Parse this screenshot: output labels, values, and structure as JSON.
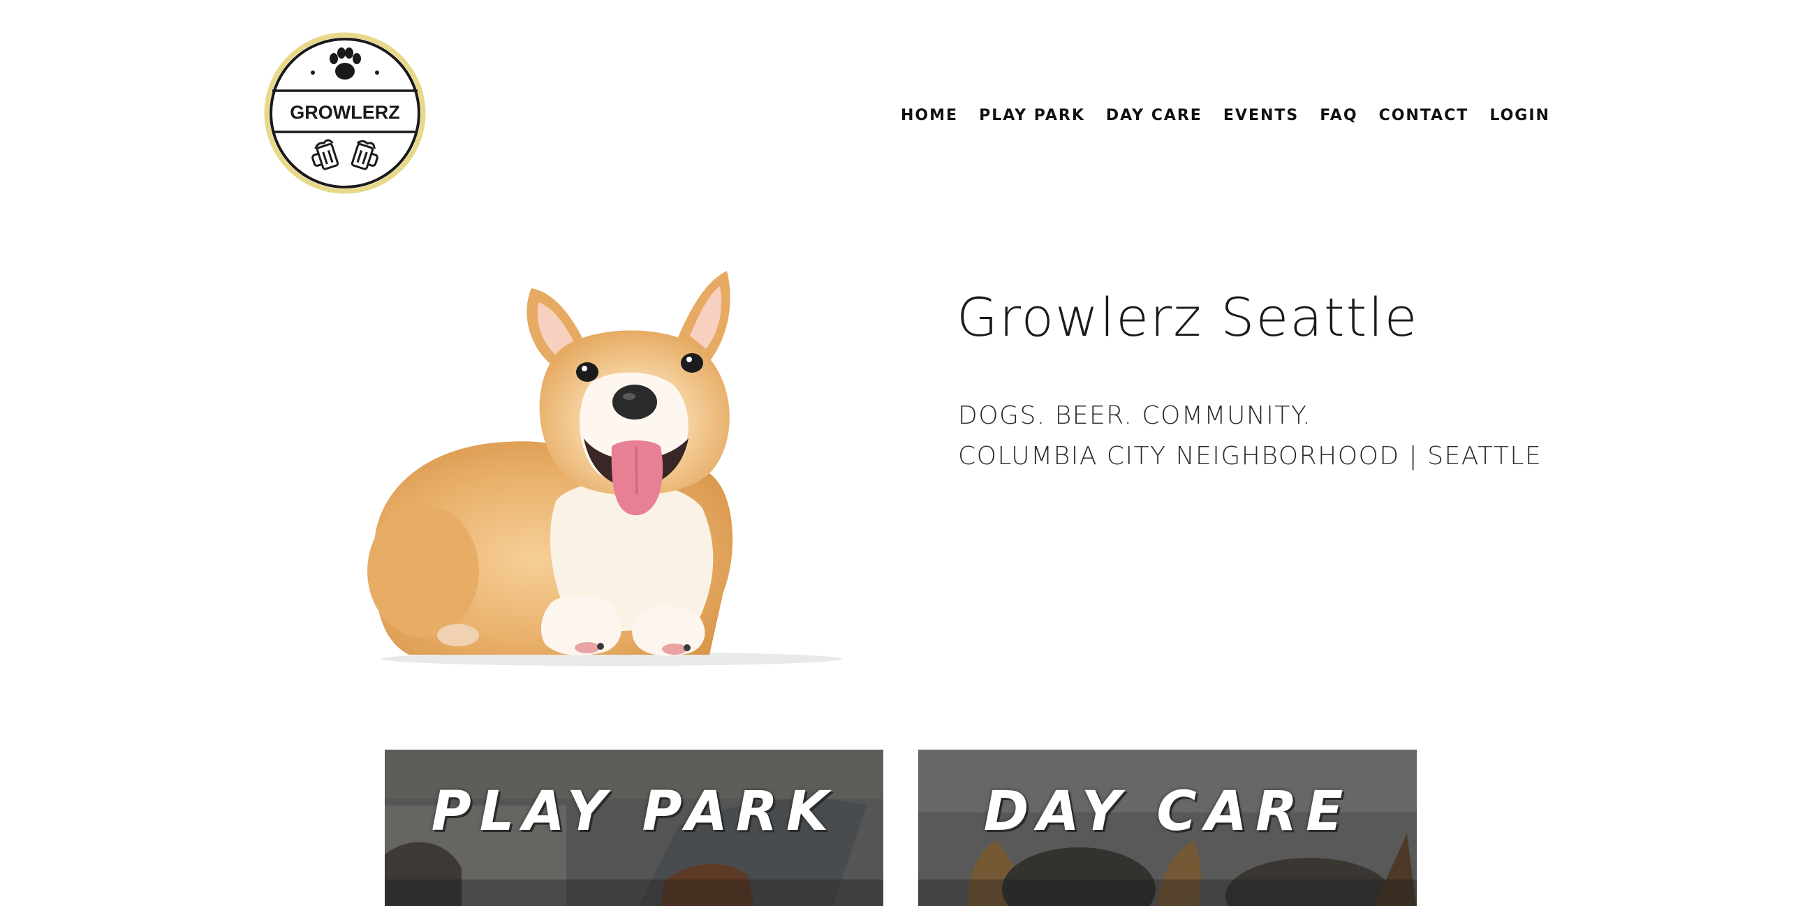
{
  "colors": {
    "logo_ring_accent": "#e8d98a",
    "logo_ink": "#1a1a1a",
    "nav_text": "#111111",
    "heading_text": "#1a1a1a",
    "card_overlay": "#3c3c3c"
  },
  "logo": {
    "text": "GROWLERZ",
    "icons": [
      "paw-icon",
      "beer-mugs-icon"
    ]
  },
  "nav": {
    "items": [
      {
        "label": "HOME"
      },
      {
        "label": "PLAY PARK"
      },
      {
        "label": "DAY CARE"
      },
      {
        "label": "EVENTS"
      },
      {
        "label": "FAQ"
      },
      {
        "label": "CONTACT"
      },
      {
        "label": "LOGIN"
      }
    ]
  },
  "hero": {
    "image": "corgi-dog",
    "title": "Growlerz Seattle",
    "tagline": "DOGS. BEER. COMMUNITY.",
    "location": "COLUMBIA CITY NEIGHBORHOOD | SEATTLE"
  },
  "cards": [
    {
      "title": "PLAY PARK"
    },
    {
      "title": "DAY CARE"
    }
  ]
}
